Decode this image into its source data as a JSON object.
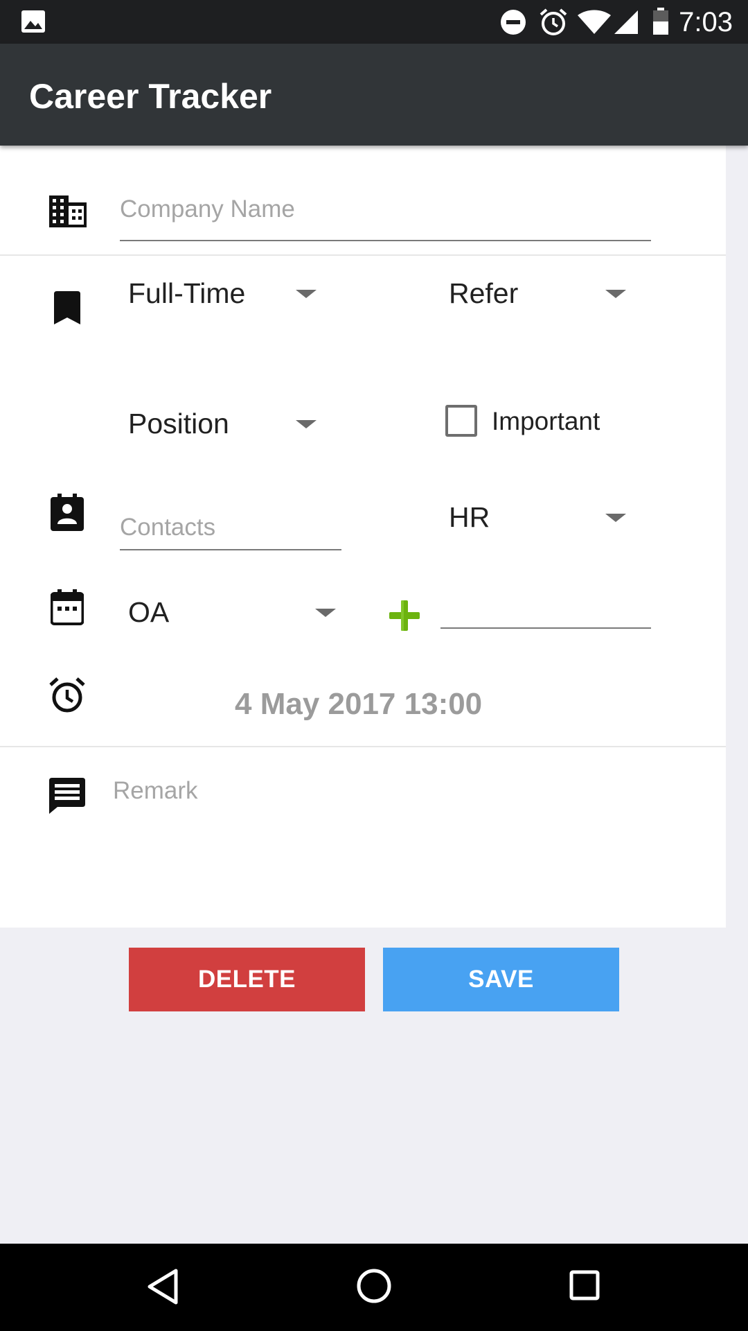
{
  "status_bar": {
    "time": "7:03",
    "icons": [
      "image-notification-icon",
      "do-not-disturb-icon",
      "alarm-icon",
      "wifi-icon",
      "cell-signal-icon",
      "battery-icon"
    ]
  },
  "app_bar": {
    "title": "Career Tracker"
  },
  "form": {
    "company": {
      "placeholder": "Company Name",
      "value": "",
      "icon": "building-icon"
    },
    "job_type": {
      "selected": "Full-Time",
      "icon": "bookmark-icon"
    },
    "source": {
      "selected": "Refer"
    },
    "position": {
      "selected": "Position"
    },
    "important": {
      "label": "Important",
      "checked": false
    },
    "contacts": {
      "placeholder": "Contacts",
      "value": "",
      "icon": "contact-card-icon"
    },
    "contact_role": {
      "selected": "HR"
    },
    "stage": {
      "selected": "OA",
      "icon": "calendar-icon",
      "add_icon": "plus-icon",
      "extra_value": ""
    },
    "datetime": {
      "value": "4 May 2017 13:00",
      "icon": "alarm-clock-icon"
    },
    "remark": {
      "placeholder": "Remark",
      "value": "",
      "icon": "comment-icon"
    }
  },
  "actions": {
    "delete_label": "DELETE",
    "save_label": "SAVE",
    "delete_color": "#d13f3f",
    "save_color": "#48a2f2"
  },
  "nav_bar": {
    "icons": [
      "back-icon",
      "home-icon",
      "recents-icon"
    ]
  },
  "colors": {
    "app_bar": "#313538",
    "status_bar": "#1e1f21",
    "plus_accent": "#6cb30f"
  }
}
